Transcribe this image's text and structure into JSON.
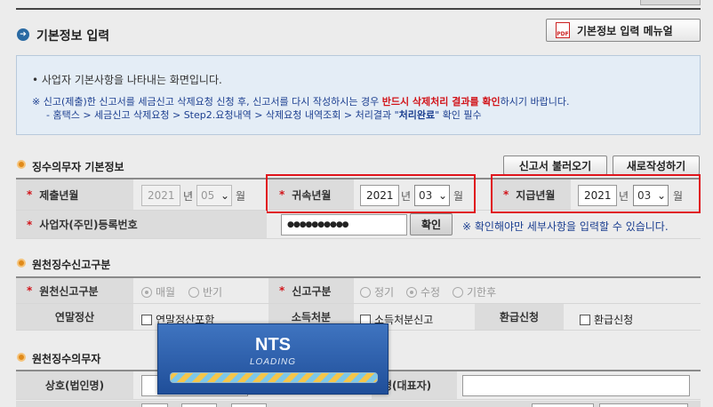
{
  "header": {
    "title": "기본정보 입력",
    "manual_button": "기본정보 입력 메뉴얼",
    "pdf_label": "PDF"
  },
  "info": {
    "line1": "• 사업자 기본사항을 나타내는 화면입니다.",
    "line2_a": "※ 신고(제출)한 신고서를 세금신고 삭제요청 신청 후, 신고서를 다시 작성하시는 경우 ",
    "line2_b": "반드시 삭제처리 결과를 확인",
    "line2_c": "하시기 바랍니다.",
    "line3_a": "- 홈택스 > 세금신고 삭제요청 > Step2.요청내역 > 삭제요청 내역조회 > 처리결과 \"",
    "line3_b": "처리완료",
    "line3_c": "\" 확인 필수"
  },
  "section1": {
    "title": "징수의무자 기본정보",
    "load_button": "신고서 불러오기",
    "new_button": "새로작성하기",
    "submit_label": "제출년월",
    "submit_year": "2021",
    "submit_month": "05",
    "attrib_label": "귀속년월",
    "attrib_year": "2021",
    "attrib_month": "03",
    "pay_label": "지급년월",
    "pay_year": "2021",
    "pay_month": "03",
    "year_unit": "년",
    "month_unit": "월",
    "biz_label": "사업자(주민)등록번호",
    "biz_value": "●●●●●●●●●●",
    "confirm_button": "확인",
    "biz_note": "※ 확인해야만 세부사항을 입력할 수 있습니다."
  },
  "section2": {
    "title": "원천징수신고구분",
    "type_label": "원천신고구분",
    "type_opt1": "매월",
    "type_opt2": "반기",
    "report_label": "신고구분",
    "report_opt1": "정기",
    "report_opt2": "수정",
    "report_opt3": "기한후",
    "yearend_label": "연말정산",
    "yearend_check": "연말정산포함",
    "income_label": "소득처분",
    "income_check": "소득처분신고",
    "refund_label": "환급신청",
    "refund_check": "환급신청"
  },
  "section3": {
    "title": "원천징수의무자",
    "name_label": "상호(법인명)",
    "rep_label_partial": "명(대표자)"
  },
  "loading": {
    "brand": "NTS",
    "text": "LOADING"
  },
  "colors": {
    "highlight": "#e0141c",
    "accent_blue": "#2a6aa3",
    "required": "#d1141a"
  }
}
